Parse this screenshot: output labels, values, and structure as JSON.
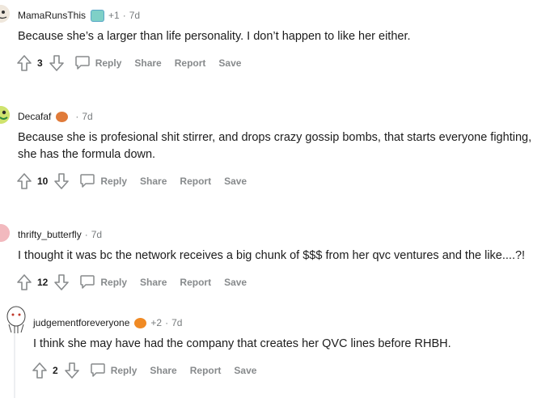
{
  "comments": [
    {
      "author": "MamaRunsThis",
      "plus": "+1",
      "time": "7d",
      "lines": [
        "Because she’s a larger than life personality. I don’t happen to like her either."
      ],
      "score": "3"
    },
    {
      "author": "Decafaf",
      "plus": "",
      "time": "7d",
      "lines": [
        "Because she is profesional shit stirrer, and drops crazy gossip bombs, that starts everyone fighting,",
        "she has the formula down."
      ],
      "score": "10"
    },
    {
      "author": "thrifty_butterfly",
      "plus": "",
      "time": "7d",
      "lines": [
        "I thought it was bc the network receives a big chunk of $$$ from her qvc ventures and the like....?!"
      ],
      "score": "12"
    },
    {
      "author": "judgementforeveryone",
      "plus": "+2",
      "time": "7d",
      "lines": [
        "I think she may have had the company that creates her QVC lines before RHBH."
      ],
      "score": "2"
    }
  ],
  "actions": {
    "reply": "Reply",
    "share": "Share",
    "report": "Report",
    "save": "Save"
  },
  "separator": "·",
  "colors": {
    "meta_gray": "#787c7e",
    "action_gray": "#878a8c",
    "text": "#1c1c1c"
  },
  "icons": [
    "upvote-icon",
    "downvote-icon",
    "comment-bubble-icon",
    "flair-icon"
  ]
}
